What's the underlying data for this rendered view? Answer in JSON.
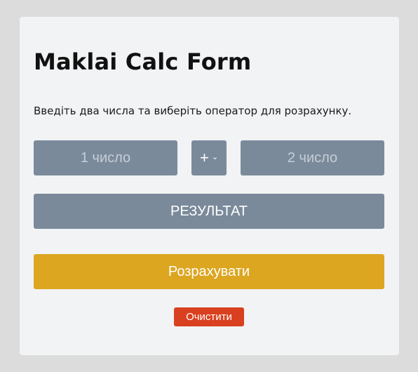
{
  "form": {
    "title": "Maklai Calc Form",
    "description": "Введіть два числа та виберіть оператор для розрахунку.",
    "first_number_placeholder": "1 число",
    "operator_value": "+",
    "second_number_placeholder": "2 число",
    "result_label": "РЕЗУЛЬТАТ",
    "calculate_label": "Розрахувати",
    "clear_label": "Очистити"
  },
  "icons": {
    "operator_dropdown": "chevron-down-icon"
  },
  "colors": {
    "page_background": "#dcdcdc",
    "card_background": "#f2f3f5",
    "field_background": "#7a8a9b",
    "calculate_button": "#dca621",
    "clear_button": "#d9401f"
  }
}
